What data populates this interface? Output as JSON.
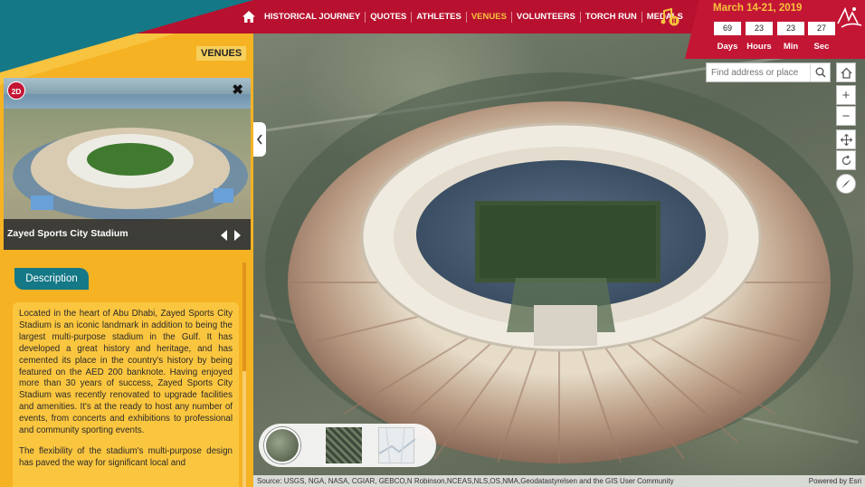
{
  "nav": {
    "items": [
      {
        "label": "HISTORICAL JOURNEY",
        "active": false
      },
      {
        "label": "QUOTES",
        "active": false
      },
      {
        "label": "ATHLETES",
        "active": false
      },
      {
        "label": "VENUES",
        "active": true
      },
      {
        "label": "VOLUNTEERS",
        "active": false
      },
      {
        "label": "TORCH RUN",
        "active": false
      },
      {
        "label": "MEDALS",
        "active": false
      }
    ]
  },
  "countdown": {
    "date": "March 14-21, 2019",
    "values": {
      "days": "69",
      "hours": "23",
      "mins": "23",
      "secs": "27"
    },
    "labels": {
      "days": "Days",
      "hours": "Hours",
      "mins": "Min",
      "secs": "Sec"
    }
  },
  "panel": {
    "title": "VENUES",
    "badge": "2D",
    "close": "✖",
    "venue_name": "Zayed Sports City Stadium",
    "desc_tab": "Description",
    "paragraphs": [
      "Located in the heart of Abu Dhabi, Zayed Sports City Stadium is an iconic landmark in addition to being the largest multi-purpose stadium in the Gulf. It has developed a great history and heritage, and has cemented its place in the country's history by being featured on the AED 200 banknote. Having enjoyed more than 30 years of success, Zayed Sports City Stadium was recently renovated to upgrade facilities and amenities. It's at the ready to host any number of events, from concerts and exhibitions to professional and community sporting events.",
      "The flexibility of the stadium's multi-purpose design has paved the way for significant local and"
    ]
  },
  "map": {
    "search_placeholder": "Find address or place",
    "attribution": "Source: USGS, NGA, NASA, CGIAR, GEBCO,N Robinson,NCEAS,NLS,OS,NMA,Geodatastyrelsen and the GIS User Community",
    "powered_by": "Powered by Esri",
    "zoom_in": "+",
    "zoom_out": "−"
  },
  "colors": {
    "header_red": "#b8112f",
    "teal": "#157887",
    "panel_yellow": "#f5b223",
    "active_nav": "#f8c33e"
  }
}
